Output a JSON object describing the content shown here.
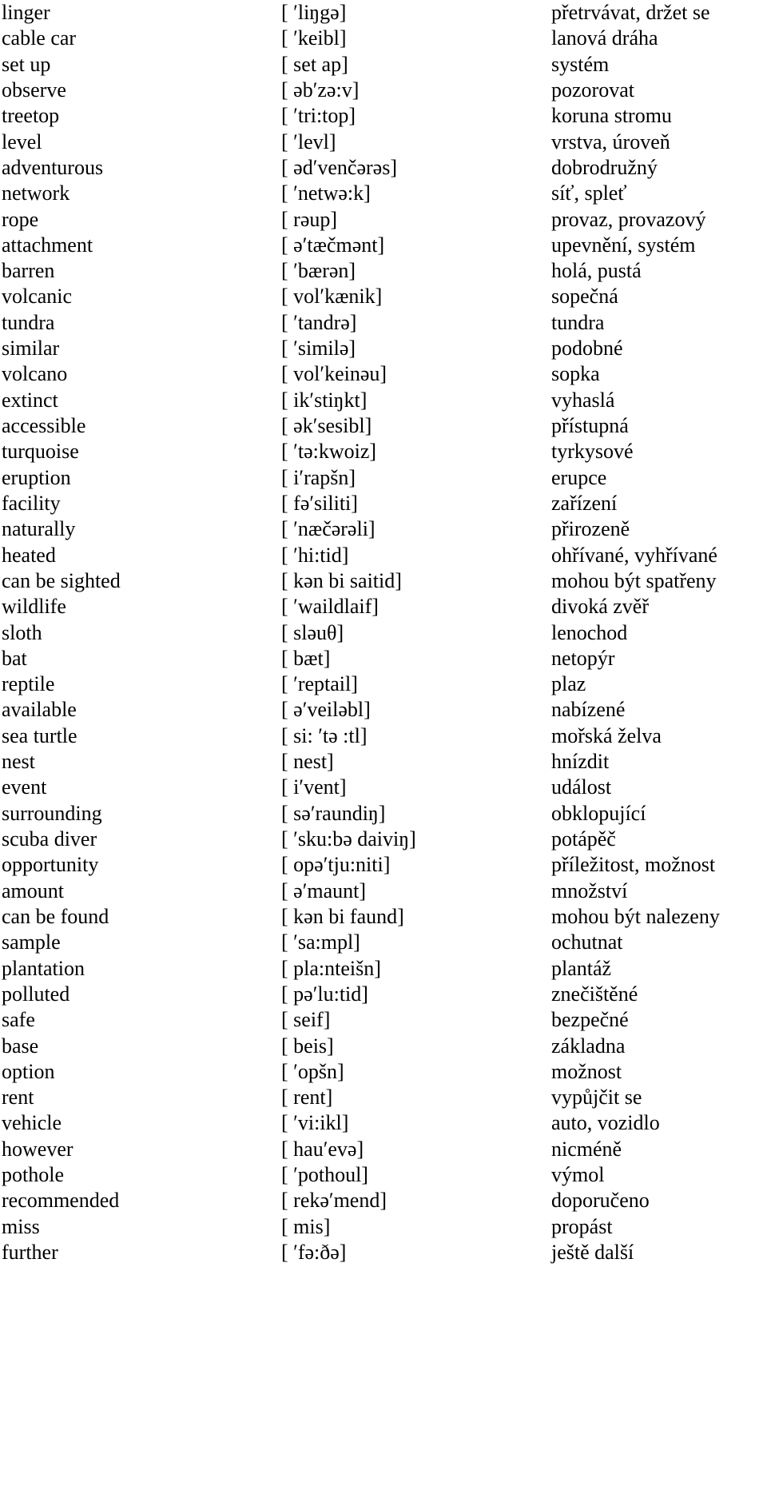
{
  "document": {
    "kind": "vocabulary-list",
    "language_pair": "English - Czech",
    "columns": [
      "term",
      "phonetic",
      "translation"
    ],
    "rows": [
      {
        "term": "linger",
        "phonetic": "[ ′liŋgə]",
        "translation": "přetrvávat, držet se"
      },
      {
        "term": "cable car",
        "phonetic": "[ ′keibl]",
        "translation": "lanová dráha"
      },
      {
        "term": "set up",
        "phonetic": "[ set ap]",
        "translation": "systém"
      },
      {
        "term": "observe",
        "phonetic": "[ əb′zə:v]",
        "translation": "pozorovat"
      },
      {
        "term": "treetop",
        "phonetic": "[ ′tri:top]",
        "translation": "koruna stromu"
      },
      {
        "term": "level",
        "phonetic": "[ ′levl]",
        "translation": "vrstva, úroveň"
      },
      {
        "term": "adventurous",
        "phonetic": "[ əd′venčərəs]",
        "translation": "dobrodružný"
      },
      {
        "term": "network",
        "phonetic": "[ ′netwə:k]",
        "translation": "síť, spleť"
      },
      {
        "term": "rope",
        "phonetic": "[ rəup]",
        "translation": "provaz, provazový"
      },
      {
        "term": "attachment",
        "phonetic": "[ ə′tæčmənt]",
        "translation": "upevnění, systém"
      },
      {
        "term": "barren",
        "phonetic": "[ ′bærən]",
        "translation": "holá, pustá"
      },
      {
        "term": "volcanic",
        "phonetic": "[ vol′kænik]",
        "translation": "sopečná"
      },
      {
        "term": "tundra",
        "phonetic": "[ ′tandrə]",
        "translation": "tundra"
      },
      {
        "term": "similar",
        "phonetic": "[ ′similə]",
        "translation": "podobné"
      },
      {
        "term": "volcano",
        "phonetic": "[ vol′keinəu]",
        "translation": "sopka"
      },
      {
        "term": "extinct",
        "phonetic": "[ ik′stiŋkt]",
        "translation": "vyhaslá"
      },
      {
        "term": "accessible",
        "phonetic": "[ ək′sesibl]",
        "translation": "přístupná"
      },
      {
        "term": "turquoise",
        "phonetic": "[ ′tə:kwoiz]",
        "translation": "tyrkysové"
      },
      {
        "term": "eruption",
        "phonetic": "[ i′rapšn]",
        "translation": "erupce"
      },
      {
        "term": "facility",
        "phonetic": "[ fə′siliti]",
        "translation": "zařízení"
      },
      {
        "term": "naturally",
        "phonetic": "[ ′næčərəli]",
        "translation": "přirozeně"
      },
      {
        "term": "heated",
        "phonetic": "[ ′hi:tid]",
        "translation": "ohřívané, vyhřívané"
      },
      {
        "term": "can be sighted",
        "phonetic": "[ kən bi saitid]",
        "translation": "mohou být spatřeny"
      },
      {
        "term": "wildlife",
        "phonetic": "[ ′waildlaif]",
        "translation": "divoká zvěř"
      },
      {
        "term": "sloth",
        "phonetic": "[ sləuθ]",
        "translation": "lenochod"
      },
      {
        "term": "bat",
        "phonetic": "[ bæt]",
        "translation": "netopýr"
      },
      {
        "term": "reptile",
        "phonetic": "[ ′reptail]",
        "translation": "plaz"
      },
      {
        "term": "available",
        "phonetic": "[ ə′veiləbl]",
        "translation": "nabízené"
      },
      {
        "term": "sea turtle",
        "phonetic": "[ si: ′tə :tl]",
        "translation": "mořská želva"
      },
      {
        "term": "nest",
        "phonetic": "[ nest]",
        "translation": "hnízdit"
      },
      {
        "term": "event",
        "phonetic": "[ i′vent]",
        "translation": "událost"
      },
      {
        "term": "surrounding",
        "phonetic": "[ sə′raundiŋ]",
        "translation": "obklopující"
      },
      {
        "term": "scuba diver",
        "phonetic": "[ ′sku:bə daiviŋ]",
        "translation": "potápěč"
      },
      {
        "term": "opportunity",
        "phonetic": "[ opə′tju:niti]",
        "translation": "příležitost, možnost"
      },
      {
        "term": "amount",
        "phonetic": "[ ə′maunt]",
        "translation": "množství"
      },
      {
        "term": "can be found",
        "phonetic": "[ kən bi faund]",
        "translation": "mohou být nalezeny"
      },
      {
        "term": "sample",
        "phonetic": "[ ′sa:mpl]",
        "translation": "ochutnat"
      },
      {
        "term": "plantation",
        "phonetic": "[ pla:nteišn]",
        "translation": "plantáž"
      },
      {
        "term": "polluted",
        "phonetic": "[ pə′lu:tid]",
        "translation": "znečištěné"
      },
      {
        "term": "safe",
        "phonetic": "[ seif]",
        "translation": "bezpečné"
      },
      {
        "term": "base",
        "phonetic": "[ beis]",
        "translation": "základna"
      },
      {
        "term": "option",
        "phonetic": "[ ′opšn]",
        "translation": "možnost"
      },
      {
        "term": "rent",
        "phonetic": "[ rent]",
        "translation": "vypůjčit se"
      },
      {
        "term": "vehicle",
        "phonetic": "[ ′vi:ikl]",
        "translation": "auto, vozidlo"
      },
      {
        "term": "however",
        "phonetic": "[ hau′evə]",
        "translation": "nicméně"
      },
      {
        "term": "pothole",
        "phonetic": "[ ′pothoul]",
        "translation": "výmol"
      },
      {
        "term": "recommended",
        "phonetic": "[ rekə′mend]",
        "translation": "doporučeno"
      },
      {
        "term": "miss",
        "phonetic": "[ mis]",
        "translation": "propást"
      },
      {
        "term": "further",
        "phonetic": "[ ′fə:ðə]",
        "translation": "ještě další"
      }
    ]
  }
}
